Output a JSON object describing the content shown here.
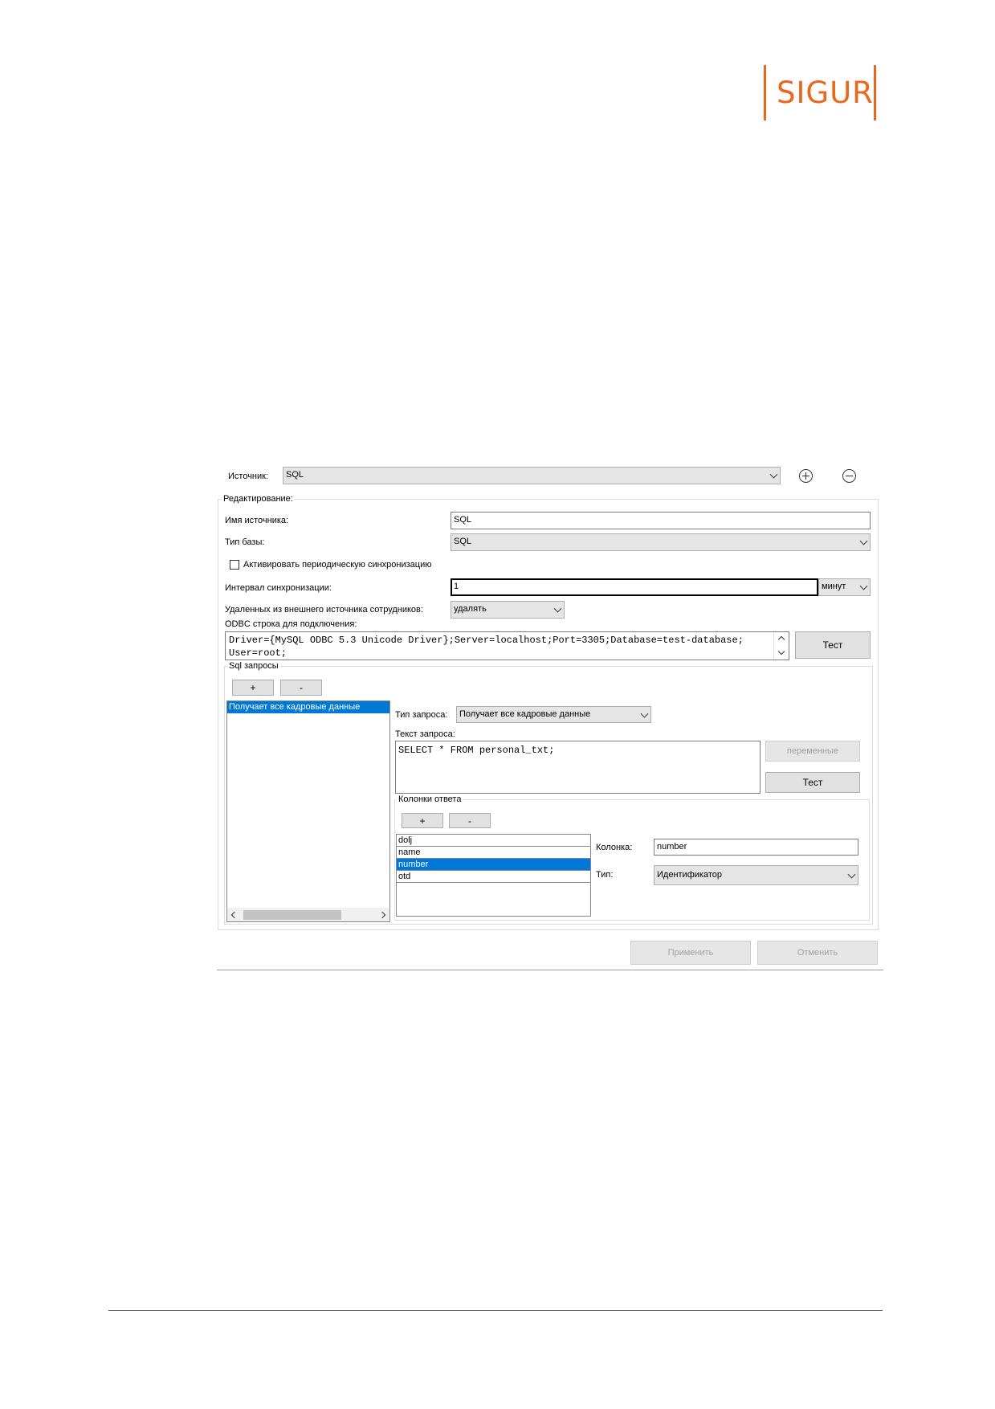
{
  "logo": {
    "text": "SIGUR",
    "color": "#e8681d"
  },
  "source": {
    "label": "Источник:",
    "value": "SQL"
  },
  "editing": {
    "title": "Редактирование:",
    "name_label": "Имя источника:",
    "name_value": "SQL",
    "db_type_label": "Тип базы:",
    "db_type_value": "SQL",
    "periodic_sync_label": "Активировать периодическую синхронизацию",
    "interval_label": "Интервал синхронизации:",
    "interval_value": "1",
    "interval_unit": "минут",
    "deleted_label": "Удаленных из внешнего источника сотрудников:",
    "deleted_value": "удалять",
    "odbc_label": "ODBC строка для подключения:",
    "odbc_line1": "Driver={MySQL ODBC 5.3 Unicode Driver};Server=localhost;Port=3305;Database=test-database;",
    "odbc_line2": "User=root;",
    "test_button": "Тест"
  },
  "sql": {
    "title": "Sql запросы",
    "add_button": "+",
    "remove_button": "-",
    "queries": [
      "Получает все кадровые данные"
    ],
    "query_type_label": "Тип запроса:",
    "query_type_value": "Получает все кадровые данные",
    "query_text_label": "Текст запроса:",
    "query_text": "SELECT * FROM personal_txt;",
    "variables_button": "переменные",
    "test_button": "Тест"
  },
  "columns": {
    "title": "Колонки ответа",
    "add_button": "+",
    "remove_button": "-",
    "items": [
      "dolj",
      "name",
      "number",
      "otd"
    ],
    "selected": "number",
    "column_label": "Колонка:",
    "column_value": "number",
    "type_label": "Тип:",
    "type_value": "Идентификатор"
  },
  "footer": {
    "apply_button": "Применить",
    "cancel_button": "Отменить"
  }
}
